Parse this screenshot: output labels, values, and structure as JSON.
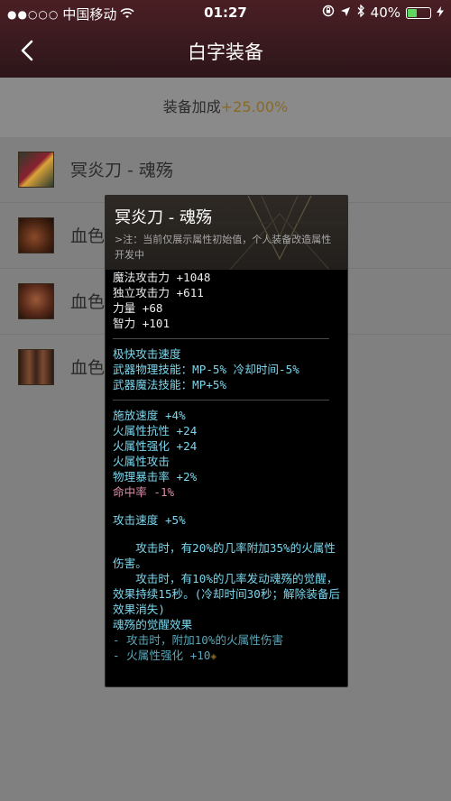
{
  "status_bar": {
    "carrier": "中国移动",
    "time": "01:27",
    "battery": "40%",
    "battery_level": 0.4
  },
  "nav": {
    "title": "白字装备"
  },
  "bonus": {
    "label": "装备加成",
    "value": "+25.00%"
  },
  "equipment": [
    {
      "name": "冥炎刀 - 魂殇",
      "icon": "sword-icon",
      "color": "#7a2230"
    },
    {
      "name": "血色",
      "icon": "shoulder-armor-icon",
      "color": "#6a3a22"
    },
    {
      "name": "血色",
      "icon": "chest-armor-icon",
      "color": "#5a2a1a"
    },
    {
      "name": "血色",
      "icon": "leg-armor-icon",
      "color": "#4a2a1e"
    }
  ],
  "tooltip": {
    "title": "冥炎刀 - 魂殇",
    "note": ">注：当前仅展示属性初始值，个人装备改造属性开发中",
    "base_stats": [
      "魔法攻击力 +1048",
      "独立攻击力 +611",
      "力量 +68",
      "智力 +101"
    ],
    "weapon_stats": [
      "极快攻击速度",
      "武器物理技能：MP-5% 冷却时间-5%",
      "武器魔法技能：MP+5%"
    ],
    "attr_stats": [
      "施放速度 +4%",
      "火属性抗性 +24",
      "火属性强化 +24",
      "火属性攻击",
      "物理暴击率 +2%"
    ],
    "hit_rate": "命中率 -1%",
    "attack_speed": "攻击速度 +5%",
    "effect_1": "攻击时，有20%的几率附加35%的火属性伤害。",
    "effect_2": "攻击时，有10%的几率发动魂殇的觉醒，效果持续15秒。(冷却时间30秒；解除装备后效果消失)",
    "awaken_title": "魂殇的觉醒效果",
    "awaken_line_1": "- 攻击时，附加10%的火属性伤害",
    "awaken_line_2": "- 火属性强化 +10"
  }
}
